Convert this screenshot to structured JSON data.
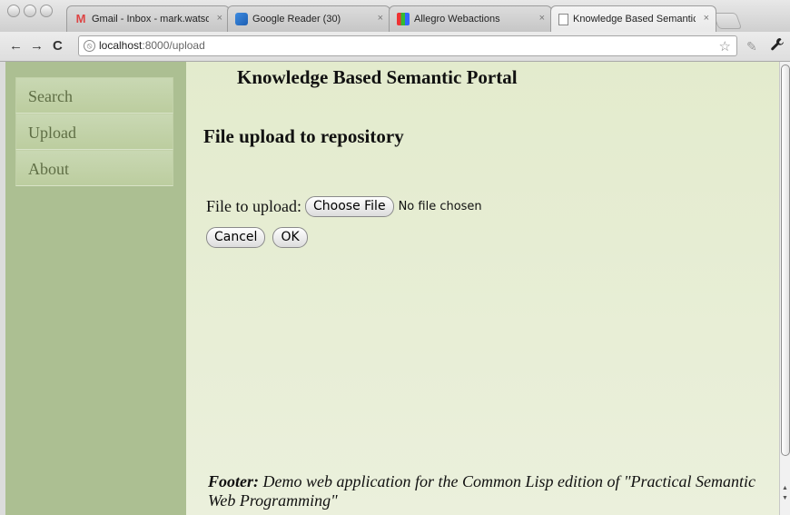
{
  "browser": {
    "tabs": [
      {
        "title": "Gmail - Inbox - mark.watson",
        "icon": "gmail-icon",
        "active": false
      },
      {
        "title": "Google Reader (30)",
        "icon": "google-reader-icon",
        "active": false
      },
      {
        "title": "Allegro Webactions",
        "icon": "allegro-icon",
        "active": false
      },
      {
        "title": "Knowledge Based Semantic P",
        "icon": "page-icon",
        "active": true
      }
    ],
    "tab_close_glyph": "×",
    "nav": {
      "back": "←",
      "forward": "→",
      "reload": "C"
    },
    "address": {
      "host": "localhost",
      "path": ":8000/upload"
    },
    "bookmark_star": "☆",
    "wrench_glyph": "🔧"
  },
  "sidebar": {
    "items": [
      {
        "label": "Search"
      },
      {
        "label": "Upload"
      },
      {
        "label": "About"
      }
    ]
  },
  "main": {
    "portal_title": "Knowledge Based Semantic Portal",
    "heading": "File upload to repository",
    "file_label": "File to upload:",
    "choose_file_label": "Choose File",
    "no_file_text": "No file chosen",
    "cancel_label": "Cancel",
    "ok_label": "OK",
    "footer_label": "Footer:",
    "footer_text": " Demo web application for the Common Lisp edition of \"Practical Semantic Web Programming\""
  },
  "colors": {
    "sidebar_bg": "#acbf92",
    "main_bg": "#e3ebcd",
    "nav_text": "#5f6e45"
  }
}
